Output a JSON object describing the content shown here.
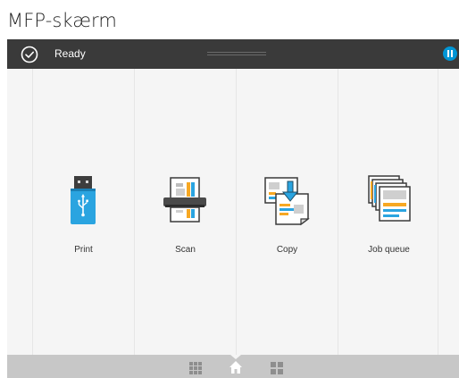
{
  "caption": "MFP-skærm",
  "status": {
    "text": "Ready",
    "check_icon": "check-circle-icon",
    "pause_icon": "pause-icon",
    "accent_color": "#0096d6"
  },
  "tiles": [
    {
      "label": "Print",
      "icon": "usb-drive-icon"
    },
    {
      "label": "Scan",
      "icon": "scanner-icon"
    },
    {
      "label": "Copy",
      "icon": "copy-icon"
    },
    {
      "label": "Job queue",
      "icon": "job-queue-icon"
    }
  ],
  "nav": {
    "items": [
      "apps-grid-icon",
      "home-icon",
      "widgets-icon"
    ],
    "active": "home-icon"
  }
}
